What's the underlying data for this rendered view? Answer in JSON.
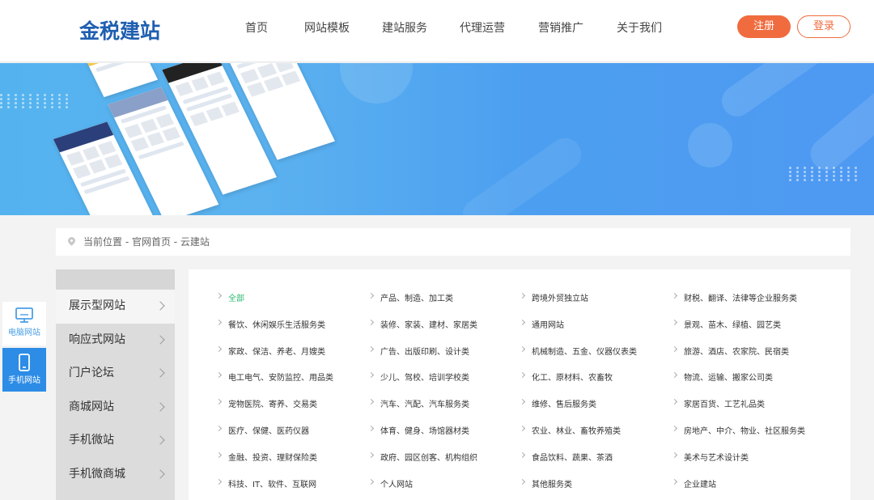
{
  "header": {
    "logo_text": "金税建站",
    "nav": [
      "首页",
      "网站模板",
      "建站服务",
      "代理运营",
      "营销推广",
      "关于我们"
    ],
    "register_label": "注册",
    "login_label": "登录"
  },
  "breadcrumb": {
    "text": "当前位置 - 官网首页 - 云建站"
  },
  "float_tabs": {
    "pc_label": "电脑网站",
    "mobile_label": "手机网站"
  },
  "menu": {
    "items": [
      "展示型网站",
      "响应式网站",
      "门户论坛",
      "商城网站",
      "手机微站",
      "手机微商城"
    ]
  },
  "categories": [
    [
      "全部",
      "产品、制造、加工类",
      "跨境外贸独立站",
      "财税、翻译、法律等企业服务类"
    ],
    [
      "餐饮、休闲娱乐生活服务类",
      "装修、家装、建材、家居类",
      "通用网站",
      "景观、苗木、绿植、园艺类"
    ],
    [
      "家政、保洁、养老、月嫂类",
      "广告、出版印刷、设计类",
      "机械制造、五金、仪器仪表类",
      "旅游、酒店、农家院、民宿类"
    ],
    [
      "电工电气、安防监控、用品类",
      "少儿、驾校、培训学校类",
      "化工、原材料、农畜牧",
      "物流、运输、搬家公司类"
    ],
    [
      "宠物医院、寄养、交易类",
      "汽车、汽配、汽车服务类",
      "维修、售后服务类",
      "家居百货、工艺礼品类"
    ],
    [
      "医疗、保健、医药仪器",
      "体育、健身、场馆器材类",
      "农业、林业、畜牧养殖类",
      "房地产、中介、物业、社区服务类"
    ],
    [
      "金融、投资、理财保险类",
      "政府、园区创客、机构组织",
      "食品饮料、蔬果、茶酒",
      "美术与艺术设计类"
    ],
    [
      "科技、IT、软件、互联网",
      "个人网站",
      "其他服务类",
      "企业建站"
    ]
  ],
  "colors": {
    "accent": "#f06c3f",
    "logo": "#1f5fb0",
    "active_category": "#2eb872",
    "banner": "#4e99f2"
  }
}
